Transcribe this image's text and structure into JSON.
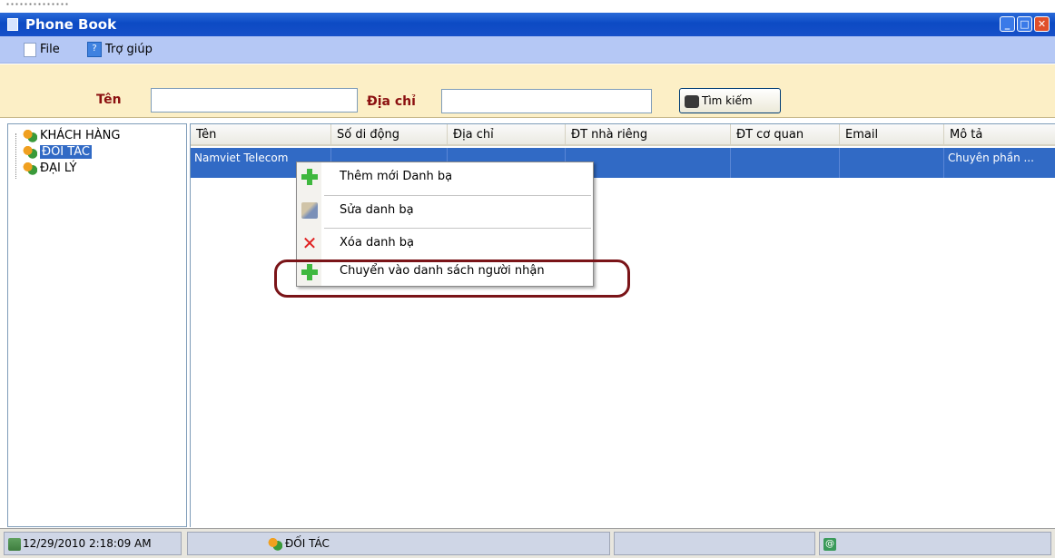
{
  "window": {
    "title": "Phone Book",
    "controls": {
      "minimize": "_",
      "maximize": "□",
      "close": "✕"
    }
  },
  "menubar": {
    "file": "File",
    "help": "Trợ giúp",
    "help_icon": "?"
  },
  "search": {
    "name_label": "Tên",
    "name_value": "",
    "address_label": "Địa chỉ",
    "address_value": "",
    "button_label": "Tìm kiếm",
    "button_icon": "binoculars-icon"
  },
  "tree": {
    "items": [
      {
        "label": "KHÁCH HÀNG",
        "selected": false
      },
      {
        "label": "ĐỐI TÁC",
        "selected": true
      },
      {
        "label": "ĐẠI LÝ",
        "selected": false
      }
    ]
  },
  "grid": {
    "columns": [
      "Tên",
      "Số di động",
      "Địa chỉ",
      "ĐT nhà riêng",
      "ĐT cơ quan",
      "Email",
      "Mô tả"
    ],
    "rows": [
      [
        "Namviet Telecom",
        "",
        "",
        "",
        "",
        "",
        "Chuyên phần ..."
      ]
    ]
  },
  "context_menu": {
    "items": [
      {
        "label": "Thêm mới Danh bạ",
        "icon": "green-plus-icon"
      },
      {
        "label": "Sửa danh bạ",
        "icon": "edit-icon"
      },
      {
        "label": "Xóa danh bạ",
        "icon": "red-x-icon"
      },
      {
        "label": "Chuyển vào danh sách người nhận",
        "icon": "green-plus-icon"
      }
    ],
    "x_glyph": "✕"
  },
  "statusbar": {
    "datetime": "12/29/2010 2:18:09 AM",
    "group": "ĐỐI TÁC",
    "panel3": "",
    "mail_icon": "@"
  },
  "colors": {
    "title_bar": "#0c4ac4",
    "menu_bar": "#b5c8f5",
    "search_panel": "#fcefc6",
    "selection": "#316ac5",
    "label_text": "#8b1010",
    "highlight_ring": "#7a1418"
  }
}
